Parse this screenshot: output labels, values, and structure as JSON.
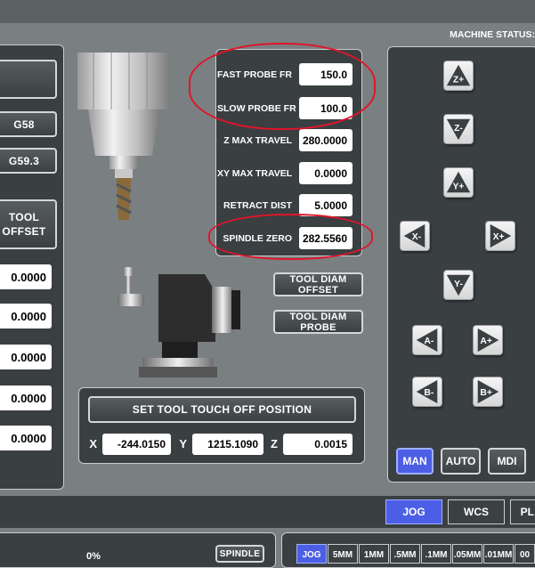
{
  "header": {
    "machine_status_label": "MACHINE STATUS:"
  },
  "left_panel": {
    "g58_label": "G58",
    "g593_label": "G59.3",
    "tool_offset_label": "TOOL\nOFFSET",
    "values": [
      "0.0000",
      "0.0000",
      "0.0000",
      "0.0000",
      "0.0000"
    ]
  },
  "probe_settings": [
    {
      "label": "FAST PROBE FR",
      "value": "150.0"
    },
    {
      "label": "SLOW PROBE FR",
      "value": "100.0"
    },
    {
      "label": "Z MAX TRAVEL",
      "value": "280.0000"
    },
    {
      "label": "XY MAX TRAVEL",
      "value": "0.0000"
    },
    {
      "label": "RETRACT DIST",
      "value": "5.0000"
    },
    {
      "label": "SPINDLE ZERO",
      "value": "282.5560"
    }
  ],
  "tool_buttons": {
    "diam_offset": "TOOL DIAM OFFSET",
    "diam_probe": "TOOL DIAM PROBE"
  },
  "touch_off": {
    "button_label": "SET TOOL TOUCH OFF POSITION",
    "x_label": "X",
    "x_value": "-244.0150",
    "y_label": "Y",
    "y_value": "1215.1090",
    "z_label": "Z",
    "z_value": "0.0015"
  },
  "jog": {
    "z_plus": "Z+",
    "z_minus": "Z-",
    "y_plus": "Y+",
    "y_minus": "Y-",
    "x_minus": "X-",
    "x_plus": "X+",
    "a_minus": "A-",
    "a_plus": "A+",
    "b_minus": "B-",
    "b_plus": "B+"
  },
  "modes": {
    "man": "MAN",
    "auto": "AUTO",
    "mdi": "MDI"
  },
  "tabs": {
    "jog": "JOG",
    "wcs": "WCS",
    "pl": "PL"
  },
  "bottom": {
    "percent": "0%",
    "spindle_label": "SPINDLE",
    "increments": [
      "JOG",
      "5MM",
      "1MM",
      ".5MM",
      ".1MM",
      ".05MM",
      ".01MM",
      "00"
    ]
  },
  "colors": {
    "accent": "#4d5ee6",
    "panel": "#3a3f42",
    "annotation": "#e0152a"
  }
}
